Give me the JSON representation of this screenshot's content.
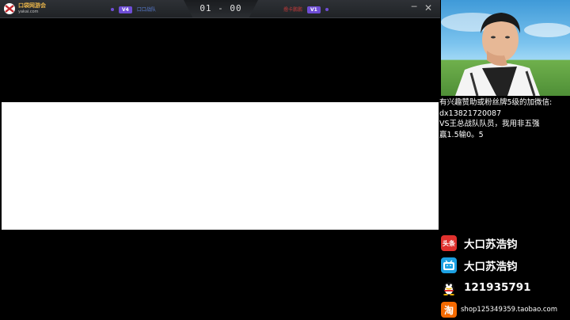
{
  "titlebar": {
    "logo": {
      "line1": "口袋网游会",
      "line2": "yakai.com"
    },
    "left_team": {
      "badge": "V4",
      "name": "口口战队"
    },
    "score": "01 - 00",
    "right_team": {
      "name": "撸卡鹏鹏",
      "badge": "V1"
    },
    "minimize_icon": "─",
    "close_icon": "✕"
  },
  "stream": {
    "notice_lines": [
      "有兴趣赞助或粉丝牌5级的加微信:",
      "dx13821720087",
      "VS王总战队队员，我用非五强",
      "赢1.5输0。5"
    ],
    "socials": [
      {
        "icon": "头条",
        "label": "大口苏浩钧"
      },
      {
        "icon": "bilibili",
        "label": "大口苏浩钧"
      },
      {
        "icon": "qq",
        "label": "121935791"
      },
      {
        "icon": "淘",
        "label": "shop125349359.taobao.com"
      }
    ]
  },
  "colors": {
    "accent_purple": "#6f4ed6",
    "left_team": "#5a7fd6",
    "right_team": "#c23a3a",
    "toutiao_red": "#e0312e",
    "bilibili_blue": "#1da1e2",
    "taobao_orange": "#f56a00"
  }
}
